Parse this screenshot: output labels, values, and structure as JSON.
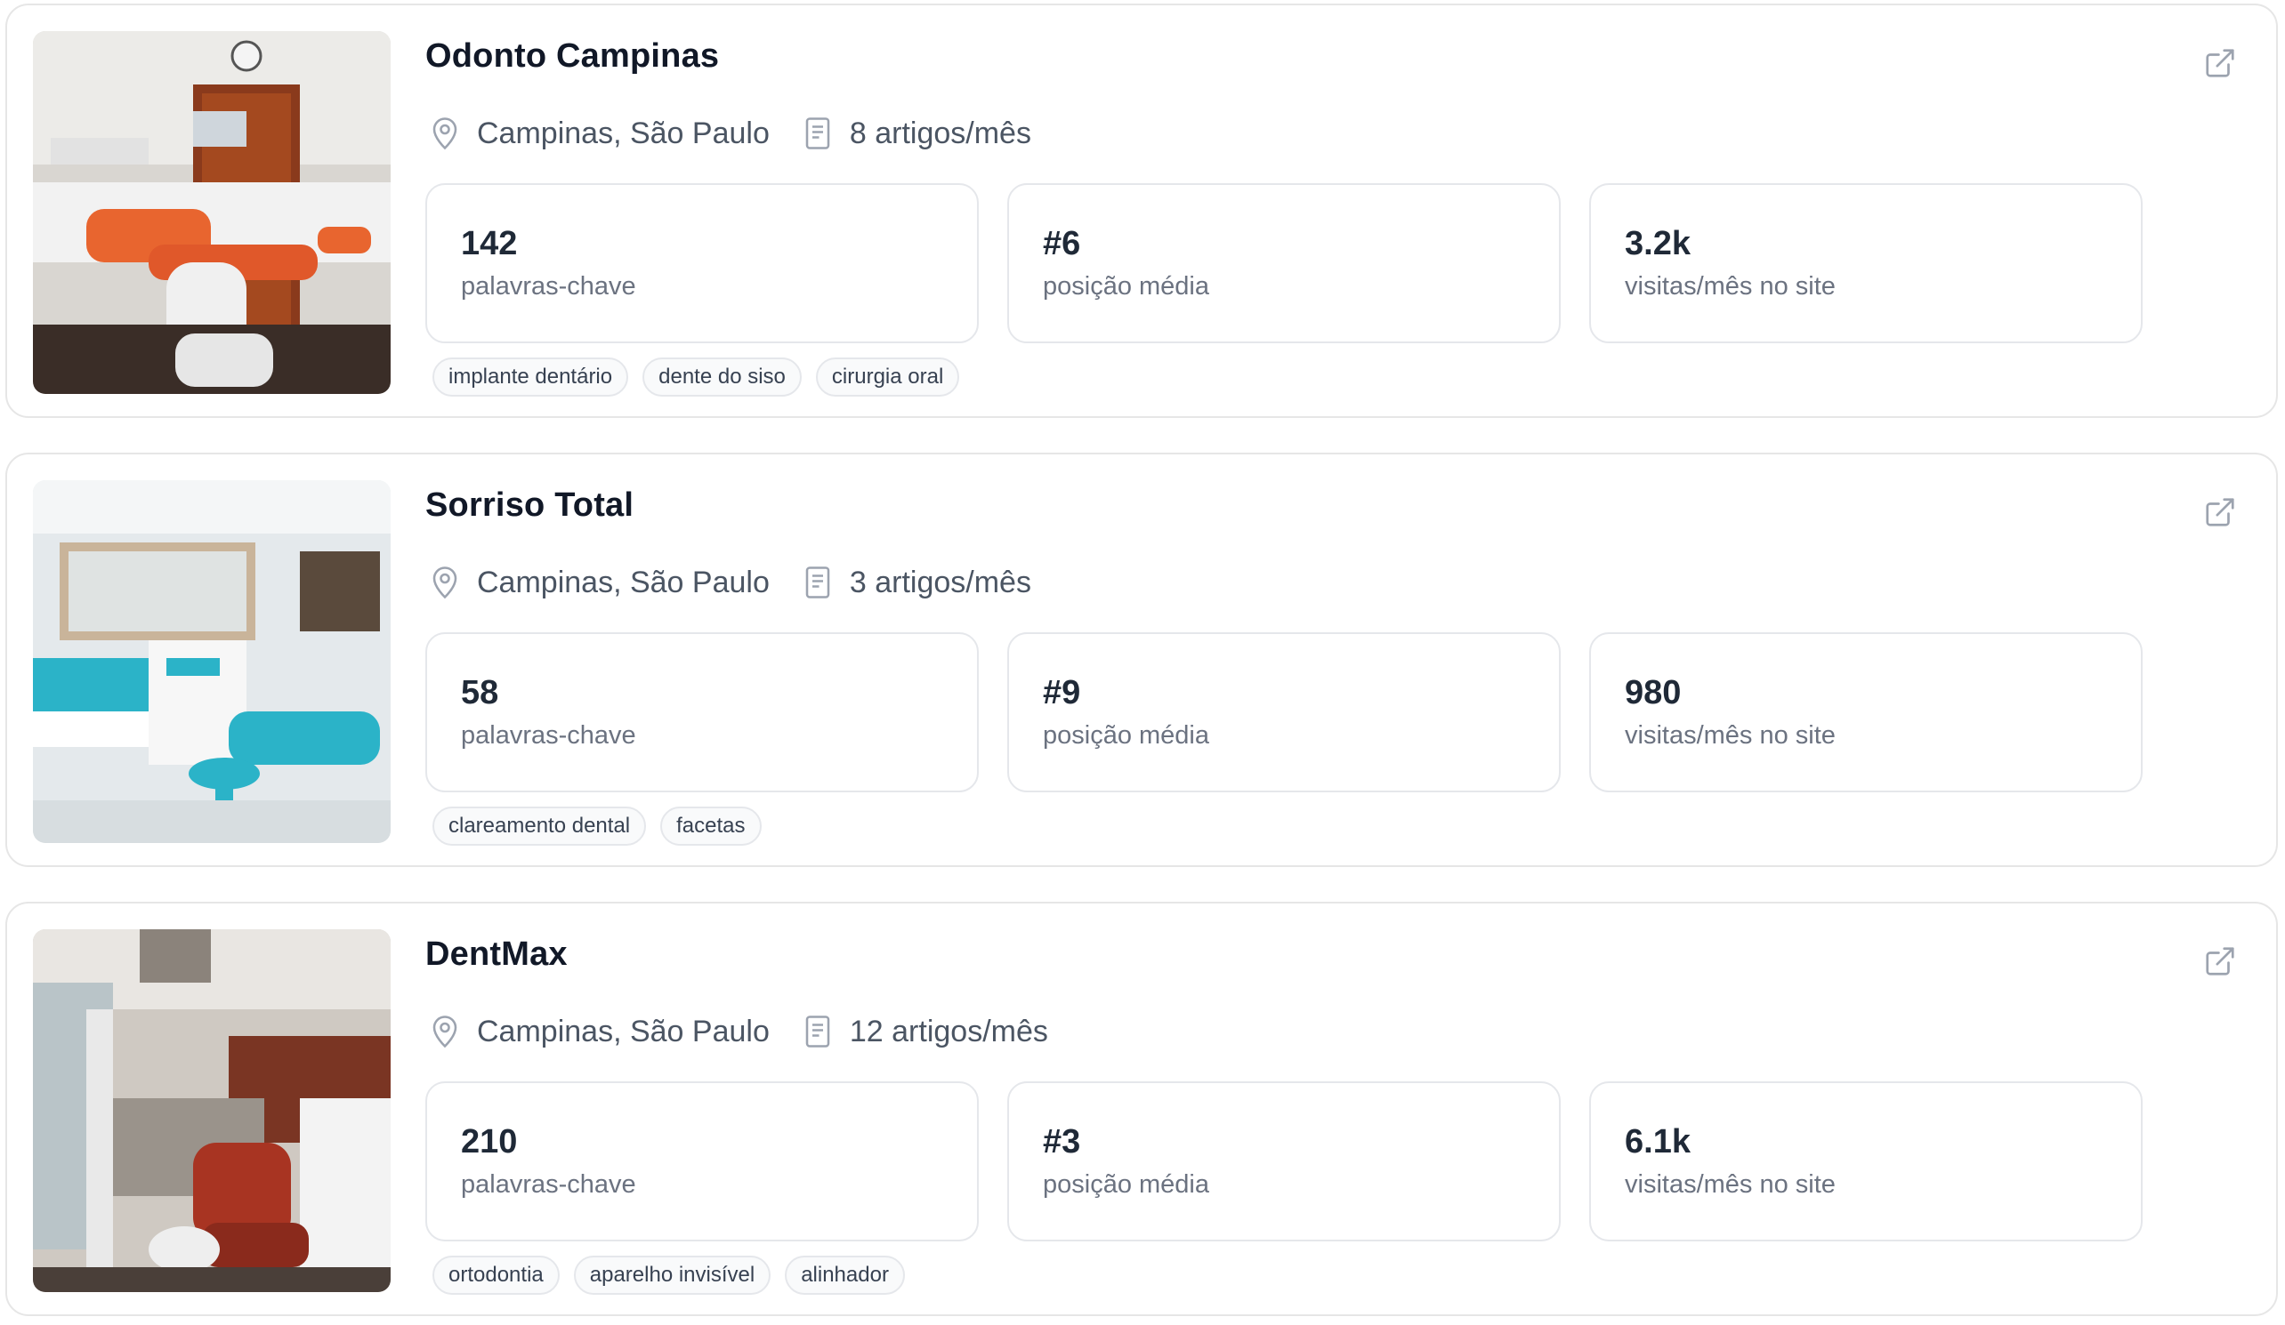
{
  "clinics": [
    {
      "name": "Odonto Campinas",
      "location": "Campinas, São Paulo",
      "articles": "8 artigos/mês",
      "stats": [
        {
          "value": "142",
          "label": "palavras-chave"
        },
        {
          "value": "#6",
          "label": "posição média"
        },
        {
          "value": "3.2k",
          "label": "visitas/mês no site"
        }
      ],
      "tags": [
        "implante dentário",
        "dente do siso",
        "cirurgia oral"
      ]
    },
    {
      "name": "Sorriso Total",
      "location": "Campinas, São Paulo",
      "articles": "3 artigos/mês",
      "stats": [
        {
          "value": "58",
          "label": "palavras-chave"
        },
        {
          "value": "#9",
          "label": "posição média"
        },
        {
          "value": "980",
          "label": "visitas/mês no site"
        }
      ],
      "tags": [
        "clareamento dental",
        "facetas"
      ]
    },
    {
      "name": "DentMax",
      "location": "Campinas, São Paulo",
      "articles": "12 artigos/mês",
      "stats": [
        {
          "value": "210",
          "label": "palavras-chave"
        },
        {
          "value": "#3",
          "label": "posição média"
        },
        {
          "value": "6.1k",
          "label": "visitas/mês no site"
        }
      ],
      "tags": [
        "ortodontia",
        "aparelho invisível",
        "alinhador"
      ]
    }
  ],
  "icons": {
    "location": "map-pin-icon",
    "articles": "document-icon",
    "open": "external-link-icon"
  },
  "colors": {
    "card_border": "#e6e6e6",
    "text_primary": "#111827",
    "text_secondary": "#4b5563",
    "icon_gray": "#9ca3af"
  }
}
